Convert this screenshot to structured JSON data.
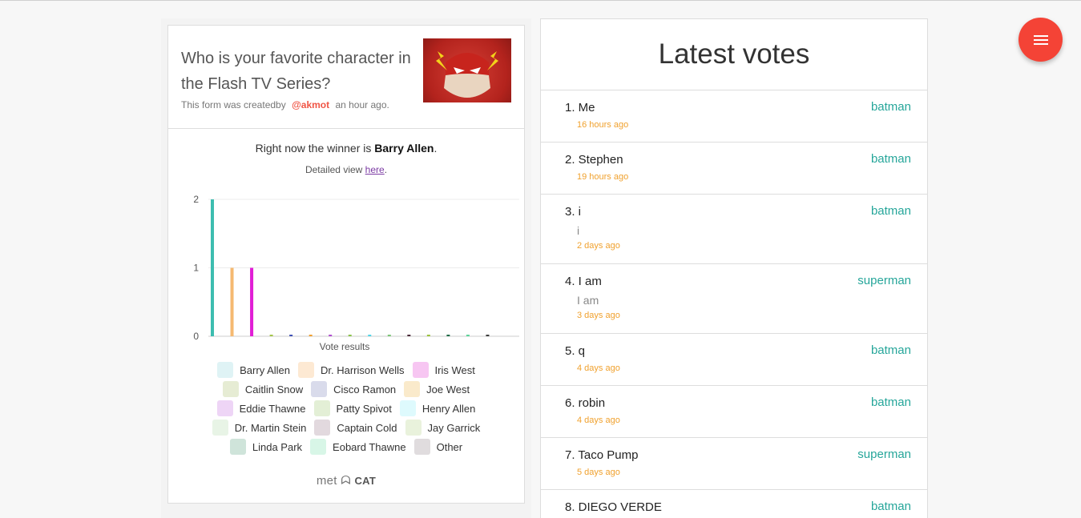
{
  "poll": {
    "question": "Who is your favorite character in the Flash TV Series?",
    "created_prefix": "This form was createdby",
    "author": "@akmot",
    "created_time": "an hour ago.",
    "winner_prefix": "Right now the winner is",
    "winner_name": "Barry Allen",
    "winner_suffix": ".",
    "detail_prefix": "Detailed view",
    "detail_link": "here",
    "detail_suffix": "."
  },
  "chart_data": {
    "type": "bar",
    "xlabel": "Vote results",
    "ylim": [
      0,
      2
    ],
    "yticks": [
      0,
      1,
      2
    ],
    "categories": [
      "Barry Allen",
      "Dr. Harrison Wells",
      "Iris West",
      "Caitlin Snow",
      "Cisco Ramon",
      "Joe West",
      "Eddie Thawne",
      "Patty Spivot",
      "Henry Allen",
      "Dr. Martin Stein",
      "Captain Cold",
      "Jay Garrick",
      "Linda Park",
      "Eobard Thawne",
      "Other"
    ],
    "values": [
      2,
      1,
      1,
      0,
      0,
      0,
      0,
      0,
      0,
      0,
      0,
      0,
      0,
      0,
      0
    ],
    "colors": [
      "#3dbdb0",
      "#f5b971",
      "#e11dd6",
      "#a4c54a",
      "#3f51b5",
      "#f0a030",
      "#b04fd0",
      "#8bc34a",
      "#4fd5e8",
      "#7cc576",
      "#4b2a3a",
      "#9bc23c",
      "#1f6b47",
      "#5ed39a",
      "#3c3c3c"
    ],
    "legend_colors": [
      "#dff3f5",
      "#fde9d3",
      "#f7c6f2",
      "#e6ecd4",
      "#d9dbeb",
      "#faeacb",
      "#eed5f6",
      "#e3efd6",
      "#defafd",
      "#e8f4e6",
      "#e2d9de",
      "#e9f2dc",
      "#cfe4da",
      "#d8f6e7",
      "#e0dcde"
    ],
    "legend_placement": "bottom"
  },
  "brand": {
    "left": "met",
    "right": "CAT"
  },
  "votes": {
    "title": "Latest votes",
    "items": [
      {
        "name": "1. Me",
        "comment": "",
        "time": "16 hours ago",
        "choice": "batman"
      },
      {
        "name": "2. Stephen",
        "comment": "",
        "time": "19 hours ago",
        "choice": "batman"
      },
      {
        "name": "3. i",
        "comment": "i",
        "time": "2 days ago",
        "choice": "batman"
      },
      {
        "name": "4. I am",
        "comment": "I am",
        "time": "3 days ago",
        "choice": "superman"
      },
      {
        "name": "5. q",
        "comment": "",
        "time": "4 days ago",
        "choice": "batman"
      },
      {
        "name": "6. robin",
        "comment": "",
        "time": "4 days ago",
        "choice": "batman"
      },
      {
        "name": "7. Taco Pump",
        "comment": "",
        "time": "5 days ago",
        "choice": "superman"
      },
      {
        "name": "8. DIEGO VERDE",
        "comment": "",
        "time": "",
        "choice": "batman"
      }
    ]
  },
  "fab": {
    "icon": "menu-icon",
    "color": "#f44336"
  }
}
